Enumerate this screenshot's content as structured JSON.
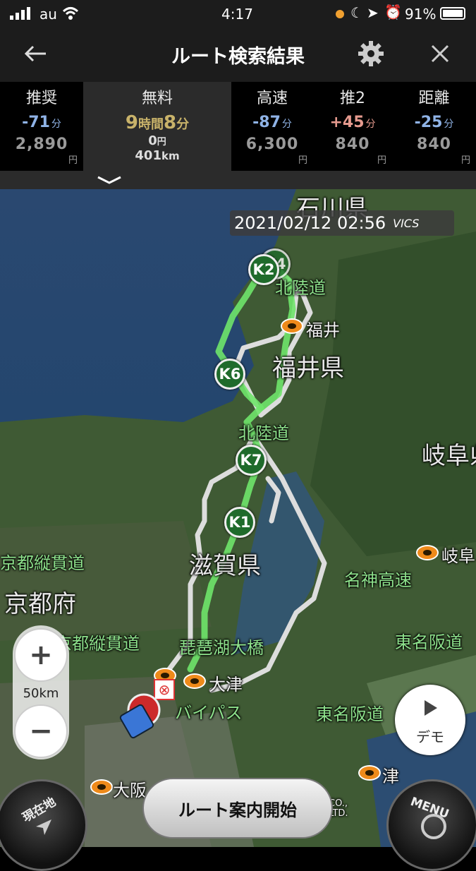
{
  "status_bar": {
    "carrier": "au",
    "time": "4:17",
    "battery": "91%"
  },
  "header": {
    "title": "ルート検索結果",
    "back_icon": "arrow-left-icon",
    "settings_icon": "gear-icon",
    "close_icon": "close-icon"
  },
  "tabs": [
    {
      "name": "推奨",
      "diff": "-71",
      "unit": "分",
      "price": "2,890",
      "yen": "円",
      "diff_color": "#8fb3e6"
    },
    {
      "name": "無料",
      "time_h": "9",
      "time_h_unit": "時間",
      "time_m": "8",
      "time_m_unit": "分",
      "toll": "0",
      "toll_unit": "円",
      "distance": "401",
      "distance_unit": "km",
      "selected": true
    },
    {
      "name": "高速",
      "diff": "-87",
      "unit": "分",
      "price": "6,300",
      "yen": "円",
      "diff_color": "#8fb3e6"
    },
    {
      "name": "推2",
      "diff": "+45",
      "unit": "分",
      "price": "840",
      "yen": "円",
      "diff_color": "#e59a8e"
    },
    {
      "name": "距離",
      "diff": "-25",
      "unit": "分",
      "price": "840",
      "yen": "円",
      "diff_color": "#8fb3e6"
    }
  ],
  "map": {
    "timestamp": "2021/02/12 02:56",
    "vics": "VICS",
    "labels": {
      "ishikawa": "石川県",
      "hokuriku1": "北陸道",
      "fukui_city": "福井",
      "fukui_pref": "福井県",
      "hokuriku2": "北陸道",
      "gifu_pref": "岐阜県",
      "shiga_pref": "滋賀県",
      "kyoto_jukan1": "京都縦貫道",
      "kyoto_pref": "京都府",
      "meishin": "名神高速",
      "gifu_city": "岐阜",
      "kyoto_jukan2": "京都縦貫道",
      "biwako": "琵琶湖大橋",
      "tomei1": "東名阪道",
      "otsu": "大津",
      "bypass": "バイパス",
      "tomei2": "東名阪道",
      "tsu": "津",
      "osaka": "大阪",
      "copyright": "CO., LTD."
    },
    "waypoints": [
      "K2",
      "K4",
      "K6",
      "K7",
      "K1"
    ]
  },
  "controls": {
    "zoom_in": "+",
    "zoom_out": "−",
    "scale": "50km",
    "demo": "デモ",
    "start_button": "ルート案内開始",
    "current_location": "現在地",
    "menu": "MENU"
  }
}
